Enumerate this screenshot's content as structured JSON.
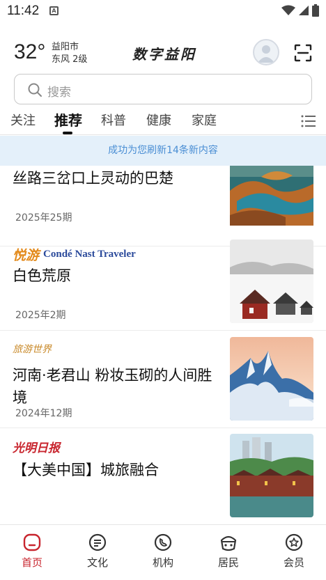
{
  "status_bar": {
    "time": "11:42",
    "notification_glyph": "A"
  },
  "header": {
    "temperature": "32°",
    "city": "益阳市",
    "wind": "东风 2级",
    "logo_text": "数字益阳"
  },
  "search": {
    "placeholder": "搜索"
  },
  "tabs": [
    {
      "label": "关注"
    },
    {
      "label": "推荐",
      "active": true
    },
    {
      "label": "科普"
    },
    {
      "label": "健康"
    },
    {
      "label": "家庭"
    }
  ],
  "refresh_notice": "成功为您刷新14条新内容",
  "feed": [
    {
      "title": "丝路三岔口上灵动的巴楚",
      "meta": "2025年25期",
      "source": ""
    },
    {
      "source_cn": "悦游",
      "source_en": "Condé Nast Traveler",
      "title": "白色荒原",
      "meta": "2025年2期"
    },
    {
      "source": "旅游世界",
      "title": "河南·老君山 粉妆玉砌的人间胜境",
      "meta": "2024年12期"
    },
    {
      "source": "光明日报",
      "title": "【大美中国】城旅融合",
      "meta": ""
    }
  ],
  "bottom_nav": [
    {
      "label": "首页",
      "icon": "home-icon",
      "active": true
    },
    {
      "label": "文化",
      "icon": "culture-icon"
    },
    {
      "label": "机构",
      "icon": "institution-icon"
    },
    {
      "label": "居民",
      "icon": "resident-icon"
    },
    {
      "label": "会员",
      "icon": "member-icon"
    }
  ],
  "colors": {
    "accent": "#c8252e",
    "notice_text": "#4a8ed4",
    "notice_bg": "#e4f0fa"
  }
}
